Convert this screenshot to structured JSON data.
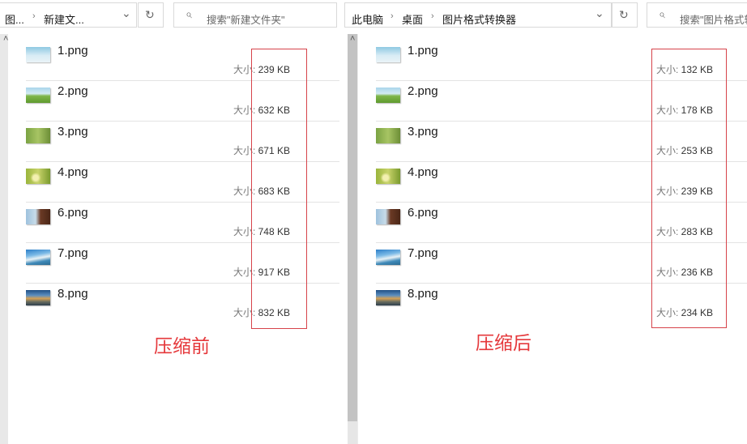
{
  "left": {
    "breadcrumb": [
      "图...",
      "新建文..."
    ],
    "search_placeholder": "搜索\"新建文件夹\"",
    "caption": "压缩前",
    "files": [
      {
        "name": "1.png",
        "size": "239 KB"
      },
      {
        "name": "2.png",
        "size": "632 KB"
      },
      {
        "name": "3.png",
        "size": "671 KB"
      },
      {
        "name": "4.png",
        "size": "683 KB"
      },
      {
        "name": "6.png",
        "size": "748 KB"
      },
      {
        "name": "7.png",
        "size": "917 KB"
      },
      {
        "name": "8.png",
        "size": "832 KB"
      }
    ]
  },
  "right": {
    "breadcrumb": [
      "此电脑",
      "桌面",
      "图片格式转换器"
    ],
    "search_placeholder": "搜索\"图片格式转",
    "caption": "压缩后",
    "files": [
      {
        "name": "1.png",
        "size": "132 KB"
      },
      {
        "name": "2.png",
        "size": "178 KB"
      },
      {
        "name": "3.png",
        "size": "253 KB"
      },
      {
        "name": "4.png",
        "size": "239 KB"
      },
      {
        "name": "6.png",
        "size": "283 KB"
      },
      {
        "name": "7.png",
        "size": "236 KB"
      },
      {
        "name": "8.png",
        "size": "234 KB"
      }
    ]
  },
  "size_label": "大小:",
  "icons": {
    "chevron": "⌄",
    "refresh": "↻",
    "search": "⌕",
    "separator": "›",
    "scroll_up": "˄"
  },
  "colors": {
    "highlight": "#d6434a",
    "caption": "#e5383b"
  }
}
